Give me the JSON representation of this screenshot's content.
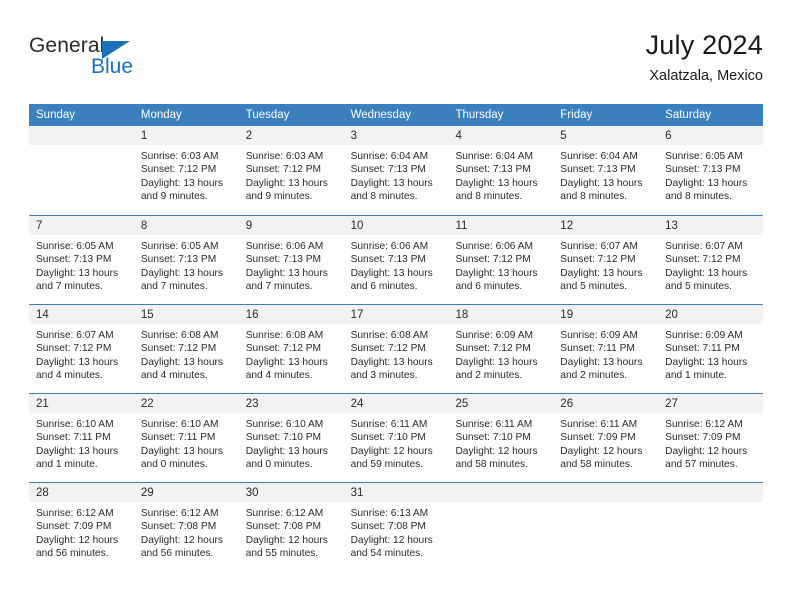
{
  "logo": {
    "word_one": "General",
    "word_two": "Blue",
    "accent_color": "#1b72b8"
  },
  "header": {
    "title": "July 2024",
    "subtitle": "Xalatzala, Mexico"
  },
  "calendar": {
    "header_color": "#3a7fbe",
    "day_band_color": "#f2f2f2",
    "weekday_headers": [
      "Sunday",
      "Monday",
      "Tuesday",
      "Wednesday",
      "Thursday",
      "Friday",
      "Saturday"
    ],
    "weeks": [
      [
        {
          "day": "",
          "lines": []
        },
        {
          "day": "1",
          "lines": [
            "Sunrise: 6:03 AM",
            "Sunset: 7:12 PM",
            "Daylight: 13 hours",
            "and 9 minutes."
          ]
        },
        {
          "day": "2",
          "lines": [
            "Sunrise: 6:03 AM",
            "Sunset: 7:12 PM",
            "Daylight: 13 hours",
            "and 9 minutes."
          ]
        },
        {
          "day": "3",
          "lines": [
            "Sunrise: 6:04 AM",
            "Sunset: 7:13 PM",
            "Daylight: 13 hours",
            "and 8 minutes."
          ]
        },
        {
          "day": "4",
          "lines": [
            "Sunrise: 6:04 AM",
            "Sunset: 7:13 PM",
            "Daylight: 13 hours",
            "and 8 minutes."
          ]
        },
        {
          "day": "5",
          "lines": [
            "Sunrise: 6:04 AM",
            "Sunset: 7:13 PM",
            "Daylight: 13 hours",
            "and 8 minutes."
          ]
        },
        {
          "day": "6",
          "lines": [
            "Sunrise: 6:05 AM",
            "Sunset: 7:13 PM",
            "Daylight: 13 hours",
            "and 8 minutes."
          ]
        }
      ],
      [
        {
          "day": "7",
          "lines": [
            "Sunrise: 6:05 AM",
            "Sunset: 7:13 PM",
            "Daylight: 13 hours",
            "and 7 minutes."
          ]
        },
        {
          "day": "8",
          "lines": [
            "Sunrise: 6:05 AM",
            "Sunset: 7:13 PM",
            "Daylight: 13 hours",
            "and 7 minutes."
          ]
        },
        {
          "day": "9",
          "lines": [
            "Sunrise: 6:06 AM",
            "Sunset: 7:13 PM",
            "Daylight: 13 hours",
            "and 7 minutes."
          ]
        },
        {
          "day": "10",
          "lines": [
            "Sunrise: 6:06 AM",
            "Sunset: 7:13 PM",
            "Daylight: 13 hours",
            "and 6 minutes."
          ]
        },
        {
          "day": "11",
          "lines": [
            "Sunrise: 6:06 AM",
            "Sunset: 7:12 PM",
            "Daylight: 13 hours",
            "and 6 minutes."
          ]
        },
        {
          "day": "12",
          "lines": [
            "Sunrise: 6:07 AM",
            "Sunset: 7:12 PM",
            "Daylight: 13 hours",
            "and 5 minutes."
          ]
        },
        {
          "day": "13",
          "lines": [
            "Sunrise: 6:07 AM",
            "Sunset: 7:12 PM",
            "Daylight: 13 hours",
            "and 5 minutes."
          ]
        }
      ],
      [
        {
          "day": "14",
          "lines": [
            "Sunrise: 6:07 AM",
            "Sunset: 7:12 PM",
            "Daylight: 13 hours",
            "and 4 minutes."
          ]
        },
        {
          "day": "15",
          "lines": [
            "Sunrise: 6:08 AM",
            "Sunset: 7:12 PM",
            "Daylight: 13 hours",
            "and 4 minutes."
          ]
        },
        {
          "day": "16",
          "lines": [
            "Sunrise: 6:08 AM",
            "Sunset: 7:12 PM",
            "Daylight: 13 hours",
            "and 4 minutes."
          ]
        },
        {
          "day": "17",
          "lines": [
            "Sunrise: 6:08 AM",
            "Sunset: 7:12 PM",
            "Daylight: 13 hours",
            "and 3 minutes."
          ]
        },
        {
          "day": "18",
          "lines": [
            "Sunrise: 6:09 AM",
            "Sunset: 7:12 PM",
            "Daylight: 13 hours",
            "and 2 minutes."
          ]
        },
        {
          "day": "19",
          "lines": [
            "Sunrise: 6:09 AM",
            "Sunset: 7:11 PM",
            "Daylight: 13 hours",
            "and 2 minutes."
          ]
        },
        {
          "day": "20",
          "lines": [
            "Sunrise: 6:09 AM",
            "Sunset: 7:11 PM",
            "Daylight: 13 hours",
            "and 1 minute."
          ]
        }
      ],
      [
        {
          "day": "21",
          "lines": [
            "Sunrise: 6:10 AM",
            "Sunset: 7:11 PM",
            "Daylight: 13 hours",
            "and 1 minute."
          ]
        },
        {
          "day": "22",
          "lines": [
            "Sunrise: 6:10 AM",
            "Sunset: 7:11 PM",
            "Daylight: 13 hours",
            "and 0 minutes."
          ]
        },
        {
          "day": "23",
          "lines": [
            "Sunrise: 6:10 AM",
            "Sunset: 7:10 PM",
            "Daylight: 13 hours",
            "and 0 minutes."
          ]
        },
        {
          "day": "24",
          "lines": [
            "Sunrise: 6:11 AM",
            "Sunset: 7:10 PM",
            "Daylight: 12 hours",
            "and 59 minutes."
          ]
        },
        {
          "day": "25",
          "lines": [
            "Sunrise: 6:11 AM",
            "Sunset: 7:10 PM",
            "Daylight: 12 hours",
            "and 58 minutes."
          ]
        },
        {
          "day": "26",
          "lines": [
            "Sunrise: 6:11 AM",
            "Sunset: 7:09 PM",
            "Daylight: 12 hours",
            "and 58 minutes."
          ]
        },
        {
          "day": "27",
          "lines": [
            "Sunrise: 6:12 AM",
            "Sunset: 7:09 PM",
            "Daylight: 12 hours",
            "and 57 minutes."
          ]
        }
      ],
      [
        {
          "day": "28",
          "lines": [
            "Sunrise: 6:12 AM",
            "Sunset: 7:09 PM",
            "Daylight: 12 hours",
            "and 56 minutes."
          ]
        },
        {
          "day": "29",
          "lines": [
            "Sunrise: 6:12 AM",
            "Sunset: 7:08 PM",
            "Daylight: 12 hours",
            "and 56 minutes."
          ]
        },
        {
          "day": "30",
          "lines": [
            "Sunrise: 6:12 AM",
            "Sunset: 7:08 PM",
            "Daylight: 12 hours",
            "and 55 minutes."
          ]
        },
        {
          "day": "31",
          "lines": [
            "Sunrise: 6:13 AM",
            "Sunset: 7:08 PM",
            "Daylight: 12 hours",
            "and 54 minutes."
          ]
        },
        {
          "day": "",
          "lines": []
        },
        {
          "day": "",
          "lines": []
        },
        {
          "day": "",
          "lines": []
        }
      ]
    ]
  }
}
